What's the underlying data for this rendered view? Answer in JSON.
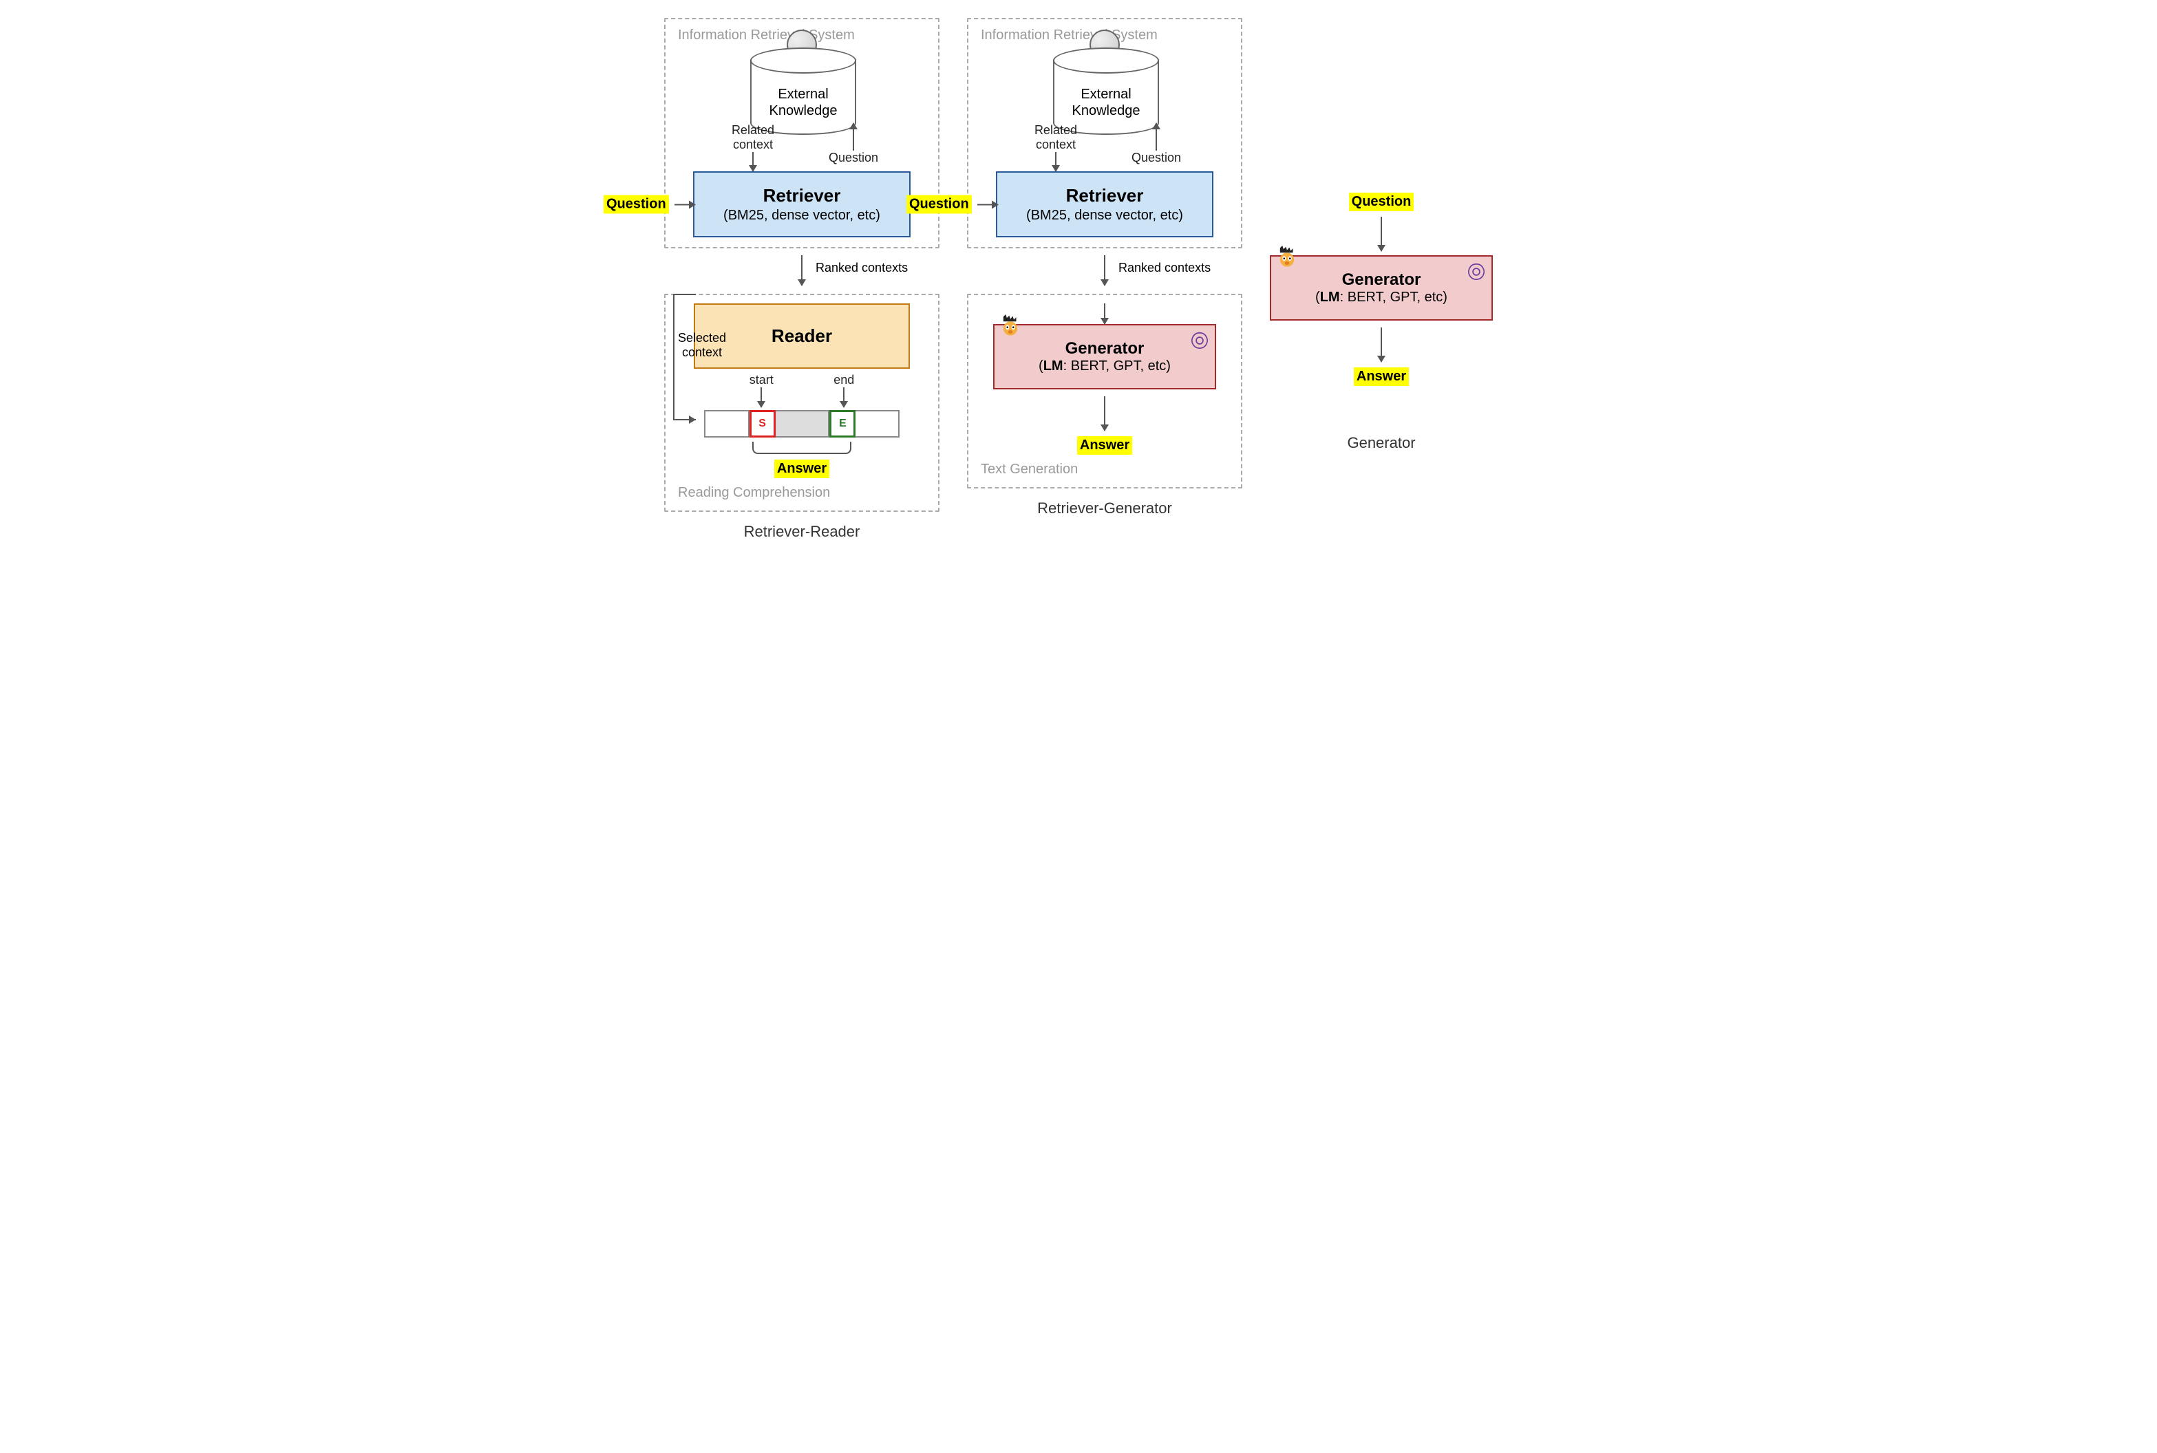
{
  "labels": {
    "ir_title": "Information Retrieval System",
    "reading_comp": "Reading Comprehension",
    "text_gen": "Text Generation",
    "external_knowledge": "External\nKnowledge",
    "related_context": "Related context",
    "question_label": "Question",
    "ranked": "Ranked contexts",
    "start": "start",
    "end": "end",
    "selected_context": "Selected context",
    "answer": "Answer",
    "s_marker": "S",
    "e_marker": "E"
  },
  "boxes": {
    "retriever_title": "Retriever",
    "retriever_sub": "(BM25, dense vector, etc)",
    "reader_title": "Reader",
    "generator_title": "Generator",
    "generator_sub_prefix": "(",
    "generator_lm": "LM",
    "generator_sub_rest": ": BERT, GPT, etc)"
  },
  "captions": {
    "col1": "Retriever-Reader",
    "col2": "Retriever-Generator",
    "col3": "Generator"
  },
  "highlight": {
    "question": "Question",
    "answer": "Answer"
  }
}
